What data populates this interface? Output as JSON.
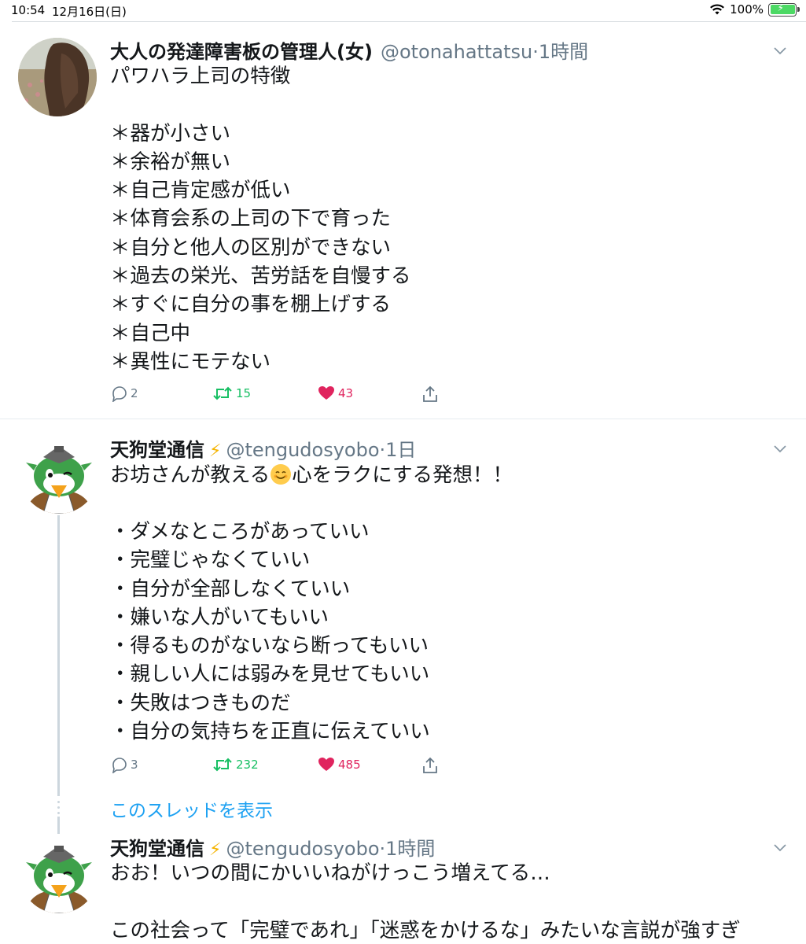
{
  "status_bar": {
    "time": "10:54",
    "date": "12月16日(日)",
    "battery": "100%",
    "icons": [
      "wifi-icon",
      "battery-charging-icon"
    ]
  },
  "tweets": [
    {
      "name": "大人の発達障害板の管理人(女)",
      "handle": "@otonahattatsu",
      "sep": "·",
      "time": "1時間",
      "text": "パワハラ上司の特徴\n\n＊器が小さい\n＊余裕が無い\n＊自己肯定感が低い\n＊体育会系の上司の下で育った\n＊自分と他人の区別ができない\n＊過去の栄光、苦労話を自慢する\n＊すぐに自分の事を棚上げする\n＊自己中\n＊異性にモテない",
      "replies": "2",
      "retweets": "15",
      "likes": "43"
    },
    {
      "name": "天狗堂通信",
      "handle": "@tengudosyobo",
      "sep": "·",
      "time": "1日",
      "text_first_a": "お坊さんが教える",
      "text_first_b": "心をラクにする発想！！",
      "text_rest": "・ダメなところがあっていい\n・完璧じゃなくていい\n・自分が全部しなくていい\n・嫌いな人がいてもいい\n・得るものがないなら断ってもいい\n・親しい人には弱みを見せてもいい\n・失敗はつきものだ\n・自分の気持ちを正直に伝えていい",
      "replies": "3",
      "retweets": "232",
      "likes": "485"
    },
    {
      "name": "天狗堂通信",
      "handle": "@tengudosyobo",
      "sep": "·",
      "time": "1時間",
      "text": "おお！いつの間にかいいねがけっこう増えてる…\n\nこの社会って「完璧であれ」「迷惑をかけるな」みたいな言説が強すぎ"
    }
  ],
  "show_thread": "このスレッドを表示",
  "colors": {
    "link": "#1da1f2",
    "retweet": "#17bf63",
    "like": "#e0245e",
    "secondary": "#657786",
    "verified_bolt": "#f5b400"
  }
}
